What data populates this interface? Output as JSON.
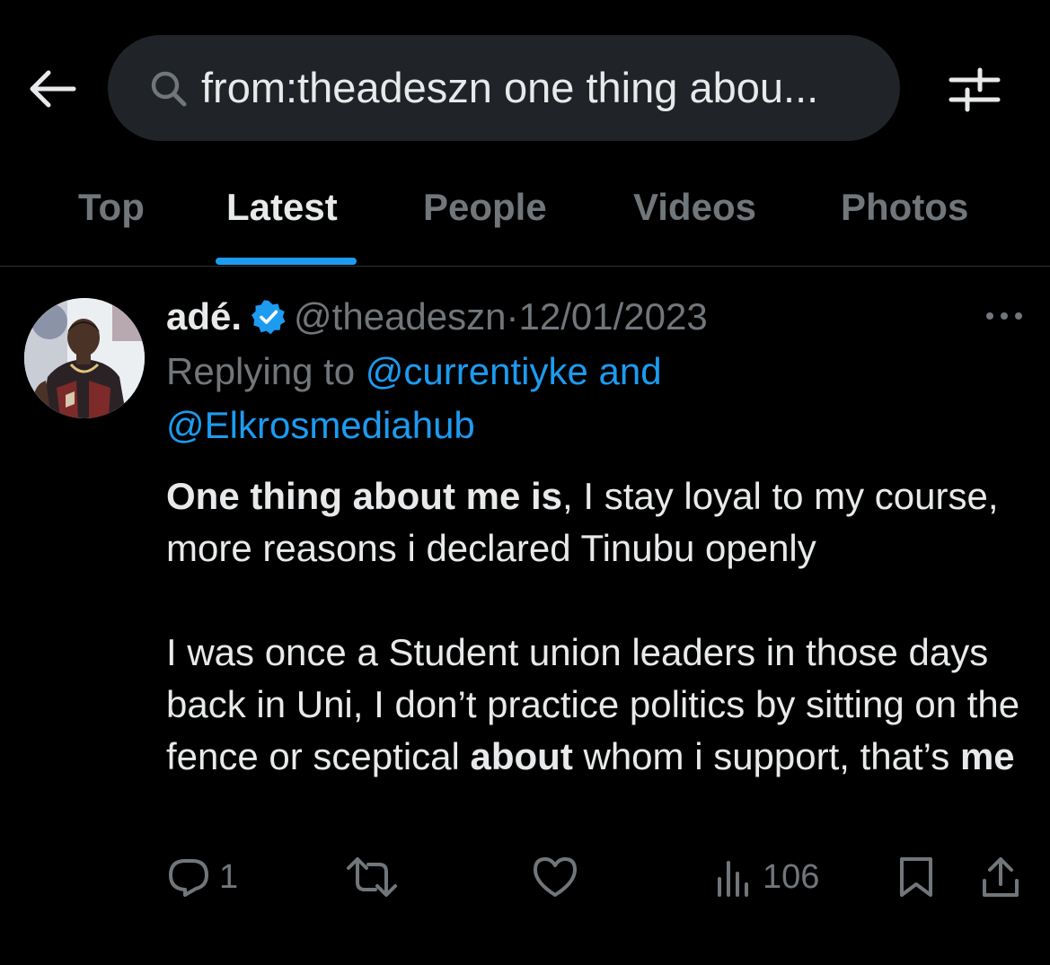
{
  "search": {
    "query": "from:theadeszn one thing abou..."
  },
  "tabs": [
    {
      "label": "Top"
    },
    {
      "label": "Latest"
    },
    {
      "label": "People"
    },
    {
      "label": "Videos"
    },
    {
      "label": "Photos"
    }
  ],
  "active_tab": "Latest",
  "tweet": {
    "name": "adé.",
    "handle": "@theadeszn",
    "separator": "·",
    "date": "12/01/2023",
    "replying_prefix": "Replying to",
    "reply_user_1": "@currentiyke",
    "reply_and": "and",
    "reply_user_2": "@Elkrosmediahub",
    "p1_bold": "One thing about me is",
    "p1_rest": ", I stay loyal to my course, more reasons i declared Tinubu openly",
    "p2_a": "I was once a Student union leaders in those days back in Uni, I don’t practice politics by sitting on the fence or sceptical ",
    "p2_bold1": "about",
    "p2_b": " whom i support, that’s ",
    "p2_bold2": "me"
  },
  "actions": {
    "replies": "1",
    "views": "106"
  },
  "colors": {
    "accent": "#1d9bf0",
    "muted": "#71767b",
    "text": "#e7e9ea",
    "background": "#000000"
  },
  "icons": {
    "back": "arrow-left-icon",
    "search": "search-icon",
    "filter": "sliders-icon",
    "verified": "verified-badge-icon",
    "more": "more-dots-icon",
    "reply": "reply-icon",
    "retweet": "retweet-icon",
    "like": "heart-icon",
    "views": "views-icon",
    "bookmark": "bookmark-icon",
    "share": "share-icon"
  }
}
